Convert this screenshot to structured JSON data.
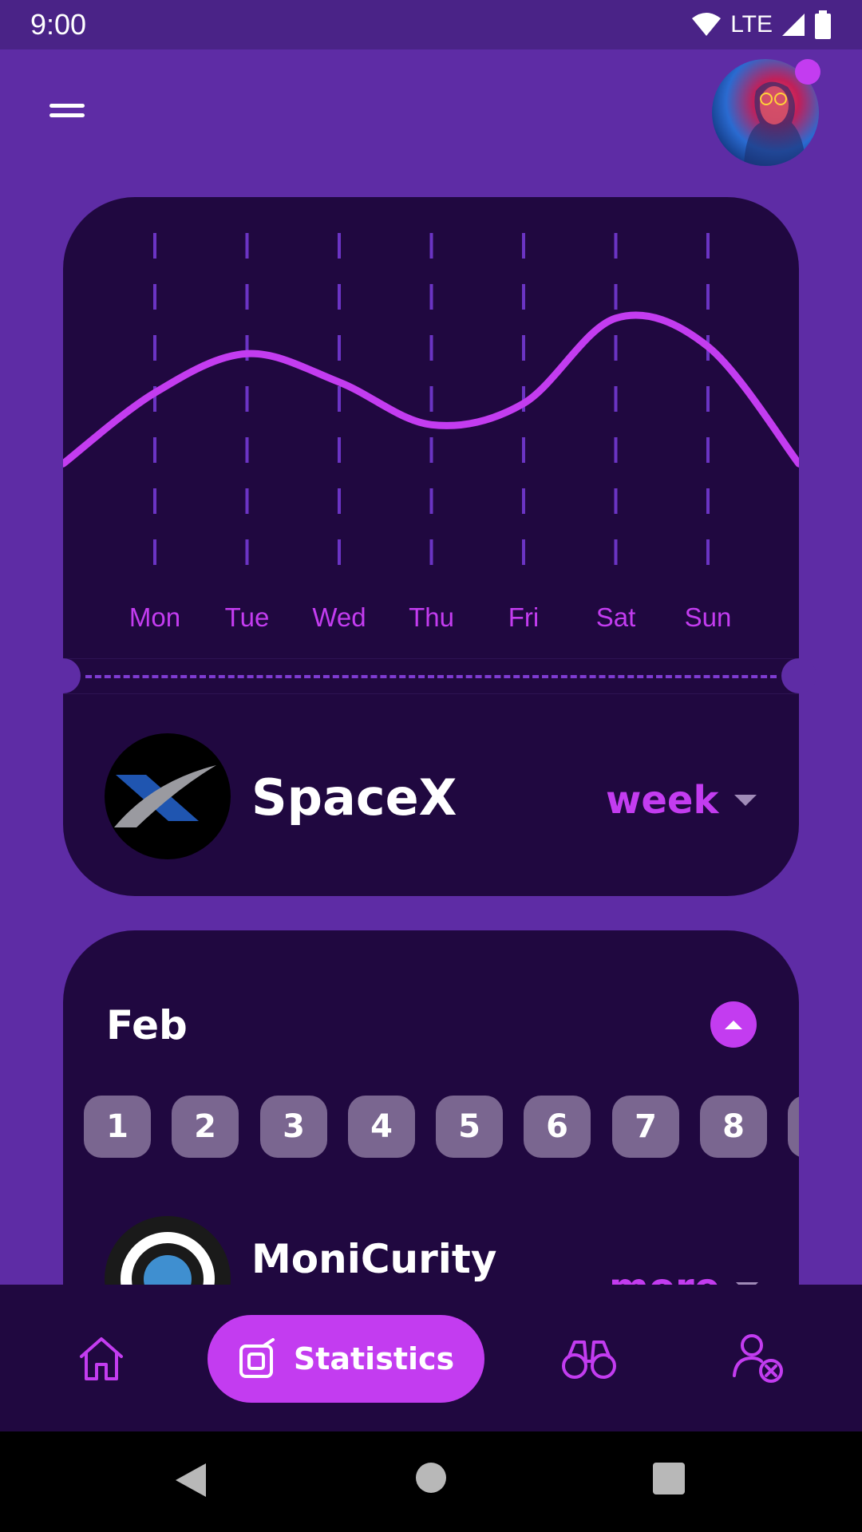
{
  "status_bar": {
    "time": "9:00",
    "network": "LTE",
    "icons": [
      "wifi-icon",
      "cell-signal-icon",
      "battery-icon"
    ]
  },
  "header": {
    "menu_icon": "hamburger-menu-icon",
    "avatar_has_notification": true
  },
  "chart_data": {
    "type": "line",
    "categories": [
      "Mon",
      "Tue",
      "Wed",
      "Thu",
      "Fri",
      "Sat",
      "Sun"
    ],
    "values": [
      0.55,
      0.66,
      0.58,
      0.46,
      0.52,
      0.76,
      0.68
    ],
    "grid": "vertical-dashed",
    "line_color": "#c33cf0"
  },
  "company": {
    "name": "SpaceX",
    "period": "week"
  },
  "calendar": {
    "month": "Feb",
    "days": [
      "1",
      "2",
      "3",
      "4",
      "5",
      "6",
      "7",
      "8"
    ]
  },
  "company2": {
    "name": "MoniCurity",
    "action": "more"
  },
  "bottom_nav": {
    "items": [
      {
        "icon": "home-icon"
      },
      {
        "icon": "statistics-icon",
        "label": "Statistics",
        "active": true
      },
      {
        "icon": "binoculars-icon"
      },
      {
        "icon": "user-remove-icon"
      }
    ]
  },
  "colors": {
    "background": "#5e2ca5",
    "card": "#200840",
    "accent": "#c33cf0",
    "chip": "#7a6690"
  }
}
